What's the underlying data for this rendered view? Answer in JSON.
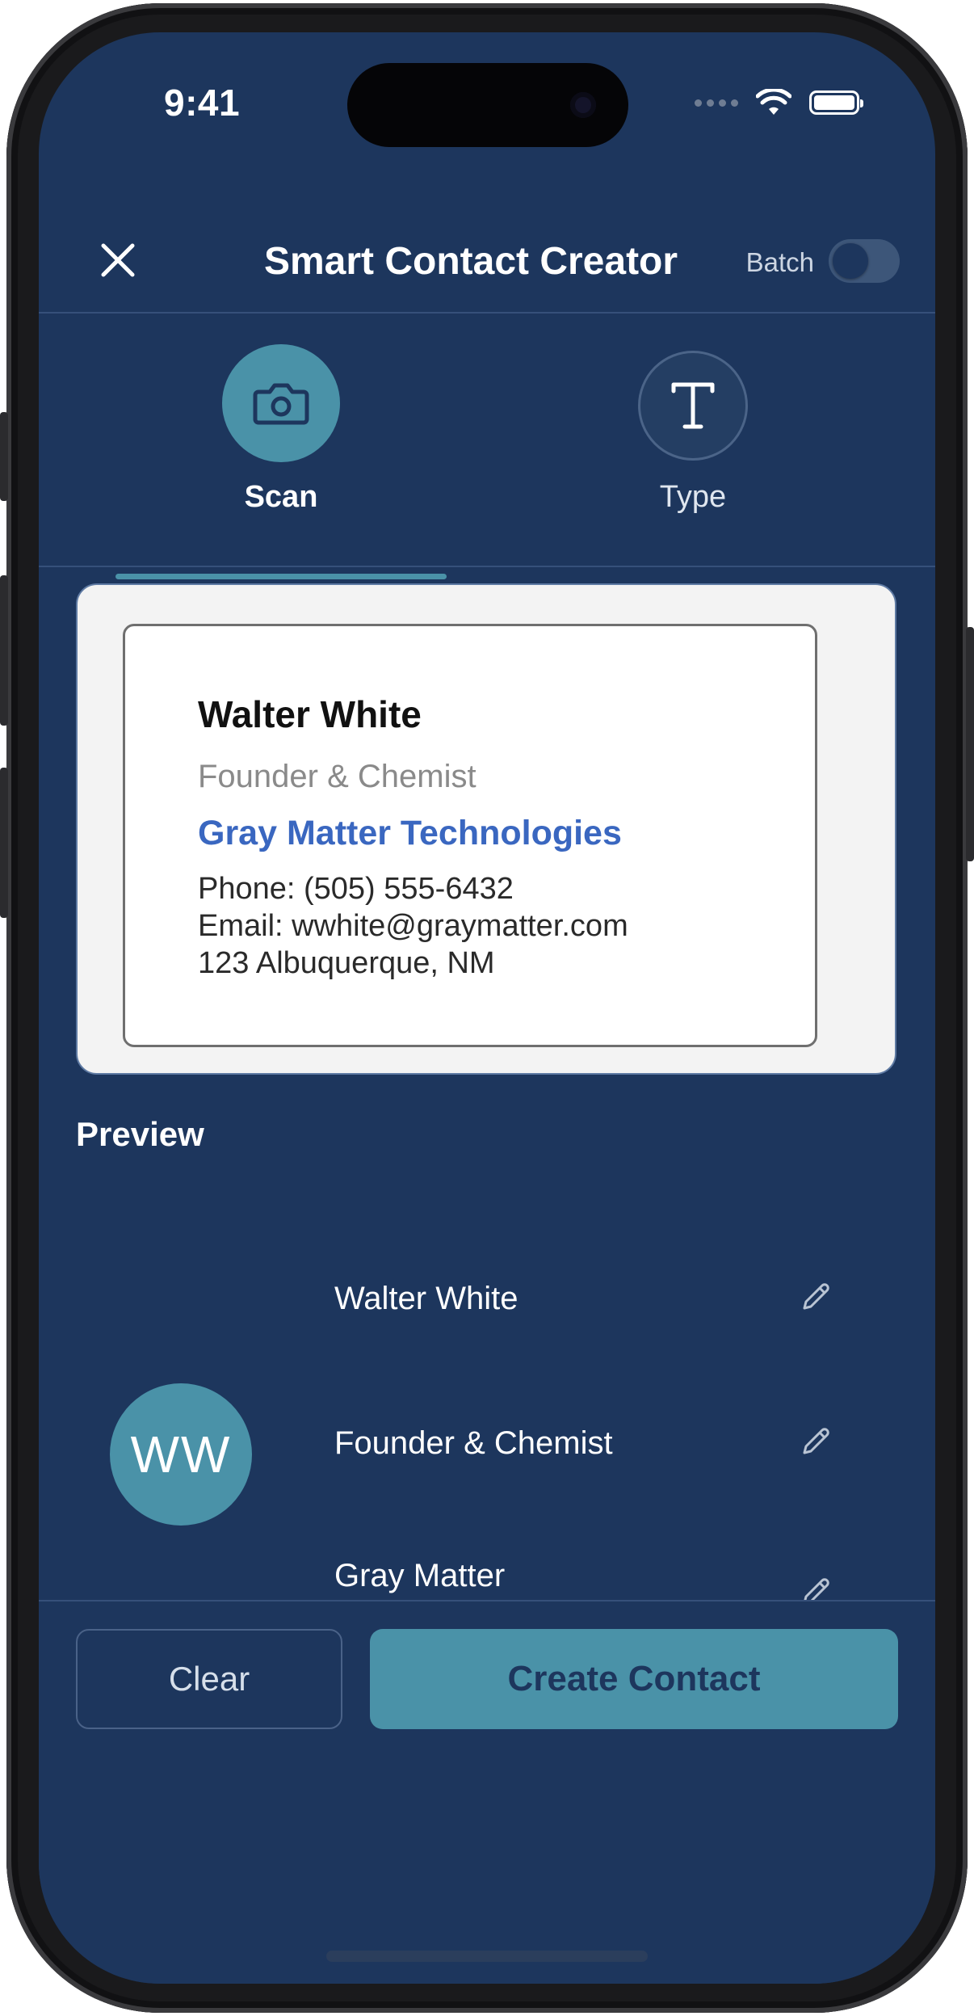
{
  "status_bar": {
    "time": "9:41"
  },
  "nav": {
    "title": "Smart Contact Creator",
    "batch_label": "Batch",
    "batch_enabled": false
  },
  "tabs": [
    {
      "label": "Scan",
      "icon": "camera-icon",
      "selected": true
    },
    {
      "label": "Type",
      "icon": "text-t-icon",
      "selected": false
    }
  ],
  "business_card": {
    "name": "Walter White",
    "role": "Founder & Chemist",
    "company": "Gray Matter Technologies",
    "phone": "Phone: (505) 555-6432",
    "email": "Email: wwhite@graymatter.com",
    "address": "123 Albuquerque, NM"
  },
  "preview": {
    "heading": "Preview",
    "avatar_initials": "WW",
    "fields": [
      {
        "value": "Walter White"
      },
      {
        "value": "Founder & Chemist"
      },
      {
        "value": "Gray Matter"
      }
    ]
  },
  "actions": {
    "clear_label": "Clear",
    "create_label": "Create Contact"
  },
  "colors": {
    "background": "#1d365d",
    "accent": "#4a92a8",
    "card_company": "#3a67c0"
  }
}
